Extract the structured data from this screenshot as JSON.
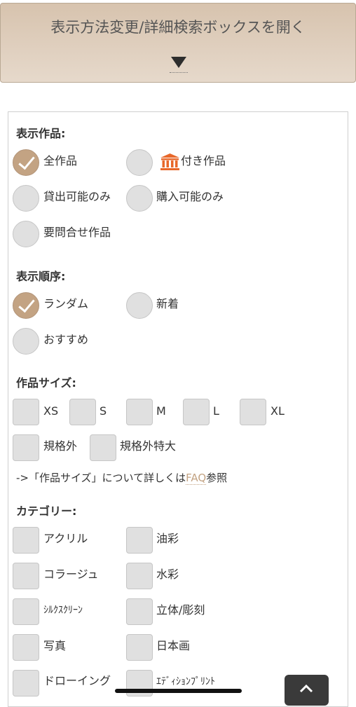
{
  "toggle": {
    "title": "表示方法変更/詳細検索ボックスを開く"
  },
  "display_works": {
    "heading": "表示作品:",
    "options": [
      {
        "label": "全作品",
        "checked": true
      },
      {
        "label": "付き作品",
        "checked": false,
        "icon": "museum-icon"
      },
      {
        "label": "貸出可能のみ",
        "checked": false
      },
      {
        "label": "購入可能のみ",
        "checked": false
      },
      {
        "label": "要問合せ作品",
        "checked": false
      }
    ]
  },
  "display_order": {
    "heading": "表示順序:",
    "options": [
      {
        "label": "ランダム",
        "checked": true
      },
      {
        "label": "新着",
        "checked": false
      },
      {
        "label": "おすすめ",
        "checked": false
      }
    ]
  },
  "work_size": {
    "heading": "作品サイズ:",
    "options": [
      "XS",
      "S",
      "M",
      "L",
      "XL",
      "規格外",
      "規格外特大"
    ],
    "note_prefix": "->「作品サイズ」について詳しくは",
    "note_link": "FAQ",
    "note_suffix": "参照"
  },
  "category": {
    "heading": "カテゴリー:",
    "options": [
      "アクリル",
      "油彩",
      "コラージュ",
      "水彩",
      "ｼﾙｸｽｸﾘｰﾝ",
      "立体/彫刻",
      "写真",
      "日本画",
      "ドローイング",
      "ｴﾃﾞｨｼｮﾝﾌﾟﾘﾝﾄ"
    ]
  },
  "colors": {
    "accent": "#c3a383",
    "museum_icon": "#e8682a"
  }
}
